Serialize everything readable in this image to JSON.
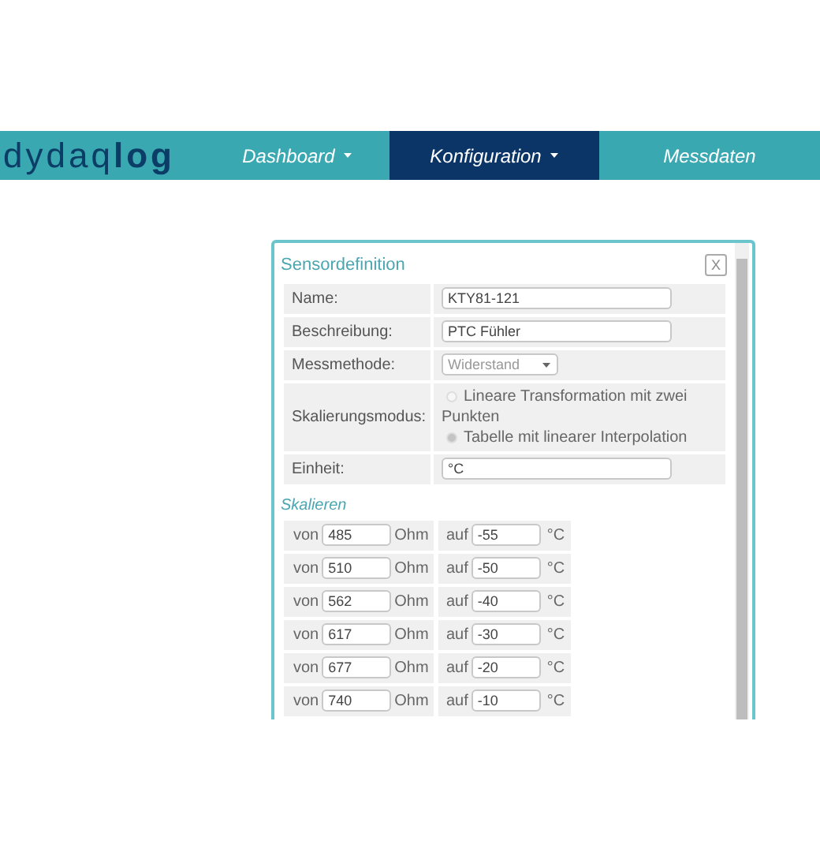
{
  "brand": "dydaq**log**",
  "nav": [
    {
      "label": "Dashboard",
      "dropdown": true,
      "selected": false
    },
    {
      "label": "Konfiguration",
      "dropdown": true,
      "selected": true
    },
    {
      "label": "Messdaten",
      "dropdown": false,
      "selected": false
    }
  ],
  "dialog": {
    "title": "Sensordefinition",
    "close": "X",
    "fields": [
      {
        "kind": "text",
        "label": "Name:",
        "value": "KTY81-121"
      },
      {
        "kind": "text",
        "label": "Beschreibung:",
        "value": "PTC Fühler"
      },
      {
        "kind": "select",
        "label": "Messmethode:",
        "value": "Widerstand"
      },
      {
        "kind": "radio",
        "label": "Skalierungsmodus:",
        "options": [
          {
            "label": "Lineare Transformation mit zwei Punkten",
            "selected": false
          },
          {
            "label": "Tabelle mit linearer Interpolation",
            "selected": true
          }
        ]
      },
      {
        "kind": "text",
        "label": "Einheit:",
        "value": "°C"
      }
    ],
    "section": "Skalieren",
    "rows": [
      {
        "from_prefix": "von",
        "from": "485",
        "from_unit": "Ohm",
        "to_prefix": "auf",
        "to": "-55",
        "to_unit": "°C"
      },
      {
        "from_prefix": "von",
        "from": "510",
        "from_unit": "Ohm",
        "to_prefix": "auf",
        "to": "-50",
        "to_unit": "°C"
      },
      {
        "from_prefix": "von",
        "from": "562",
        "from_unit": "Ohm",
        "to_prefix": "auf",
        "to": "-40",
        "to_unit": "°C"
      },
      {
        "from_prefix": "von",
        "from": "617",
        "from_unit": "Ohm",
        "to_prefix": "auf",
        "to": "-30",
        "to_unit": "°C"
      },
      {
        "from_prefix": "von",
        "from": "677",
        "from_unit": "Ohm",
        "to_prefix": "auf",
        "to": "-20",
        "to_unit": "°C"
      },
      {
        "from_prefix": "von",
        "from": "740",
        "from_unit": "Ohm",
        "to_prefix": "auf",
        "to": "-10",
        "to_unit": "°C"
      }
    ]
  }
}
